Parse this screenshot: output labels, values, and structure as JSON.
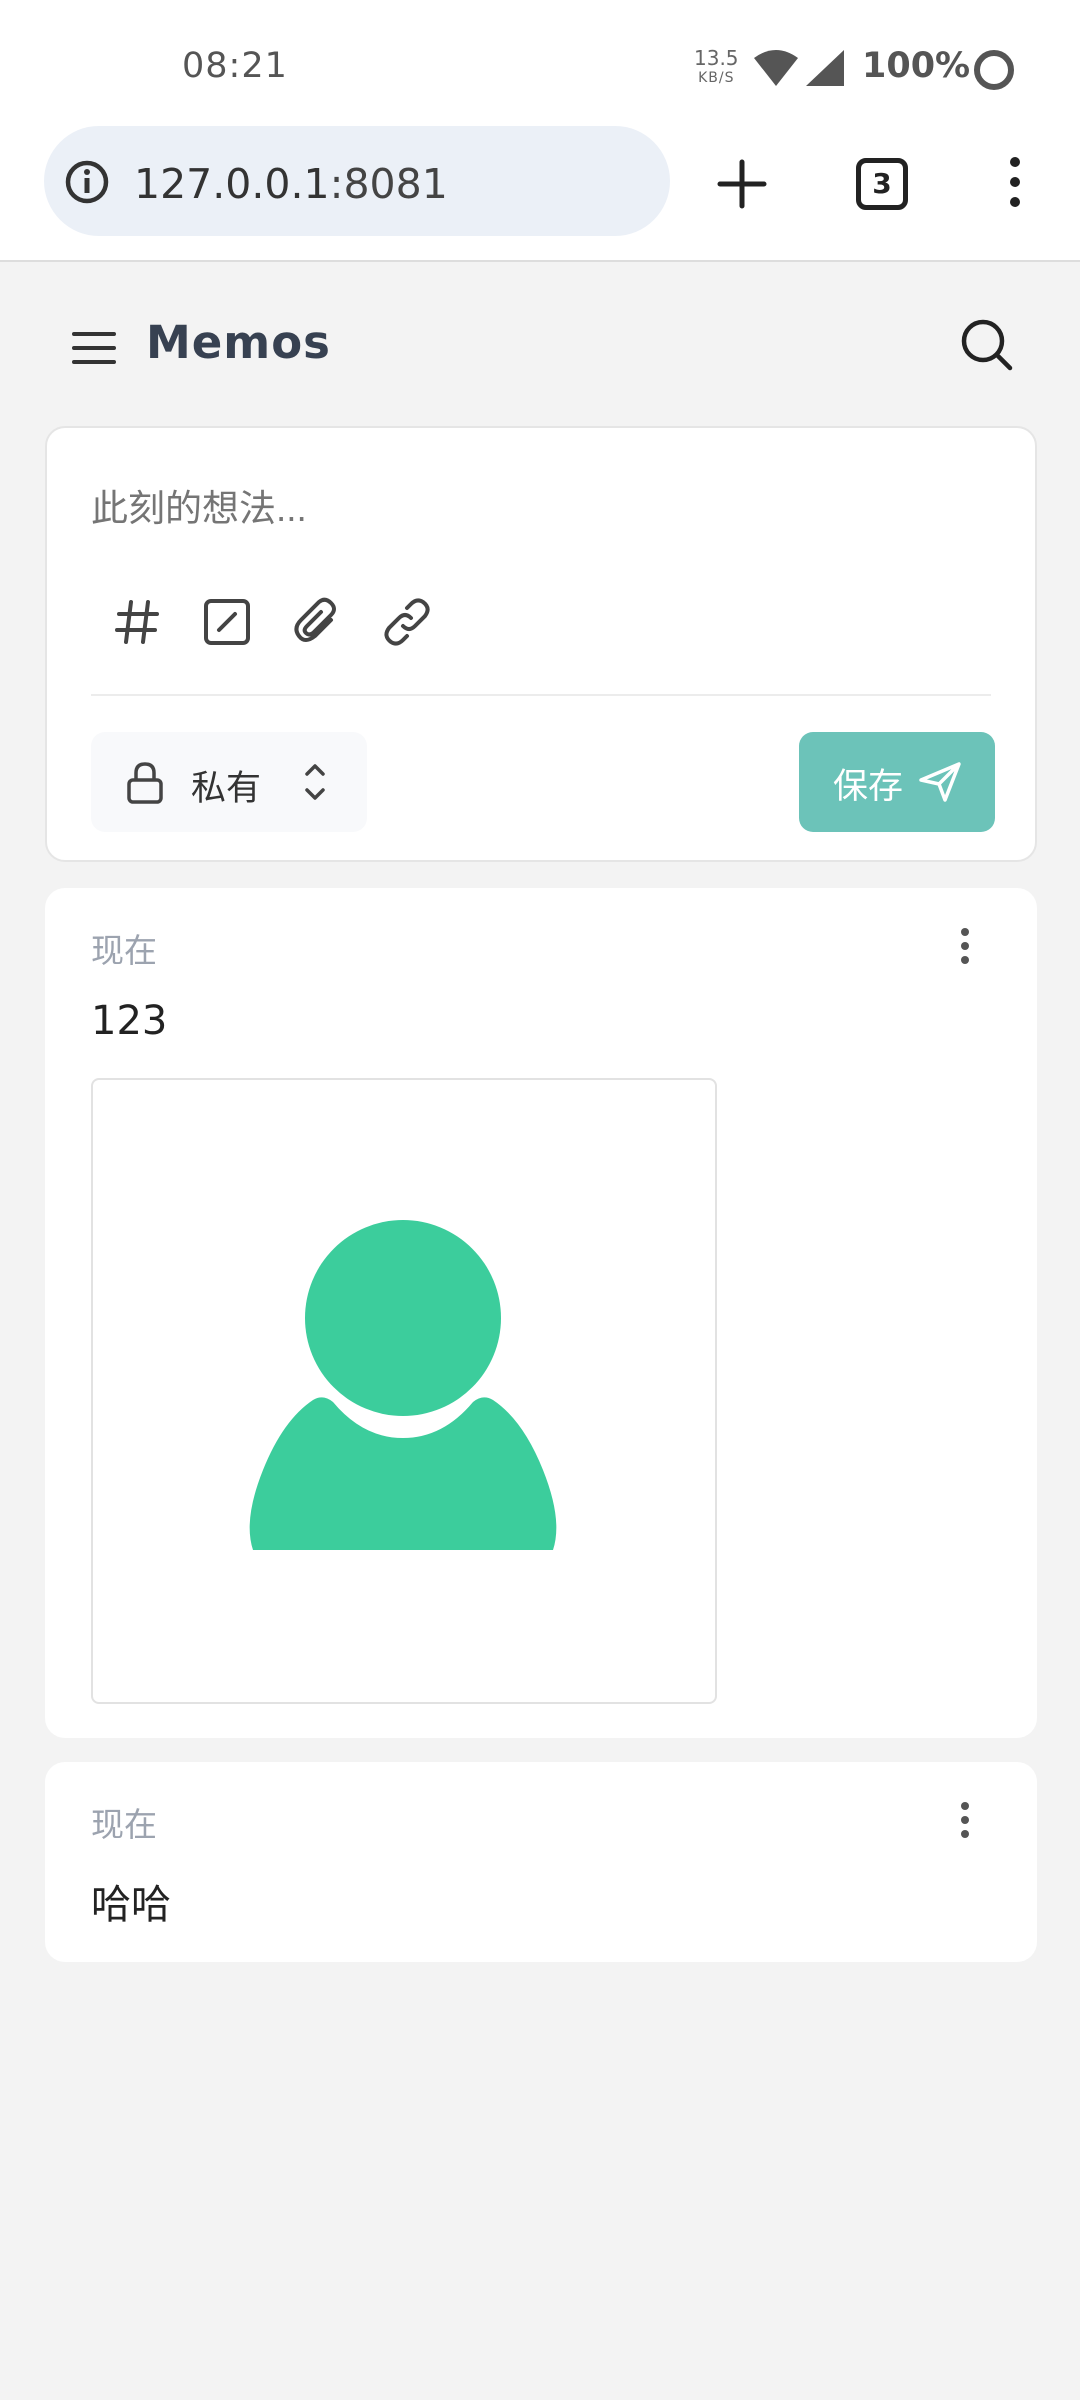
{
  "status_bar": {
    "time": "08:21",
    "net_speed": "13.5",
    "net_unit": "KB/S",
    "battery": "100%"
  },
  "browser": {
    "url_host": "127.0.0.1",
    "url_port": ":8081",
    "tab_count": "3"
  },
  "app": {
    "title": "Memos"
  },
  "editor": {
    "placeholder": "此刻的想法...",
    "visibility_label": "私有",
    "save_label": "保存",
    "toolbar_icons": [
      "hash-icon",
      "todo-icon",
      "attachment-icon",
      "link-icon"
    ]
  },
  "memos": [
    {
      "time": "现在",
      "content": "123",
      "has_image": true
    },
    {
      "time": "现在",
      "content": "哈哈",
      "has_image": false
    }
  ],
  "colors": {
    "accent": "#6cc3b9",
    "avatar_green": "#3ccd9c",
    "background": "#f3f3f3",
    "title": "#374151"
  }
}
